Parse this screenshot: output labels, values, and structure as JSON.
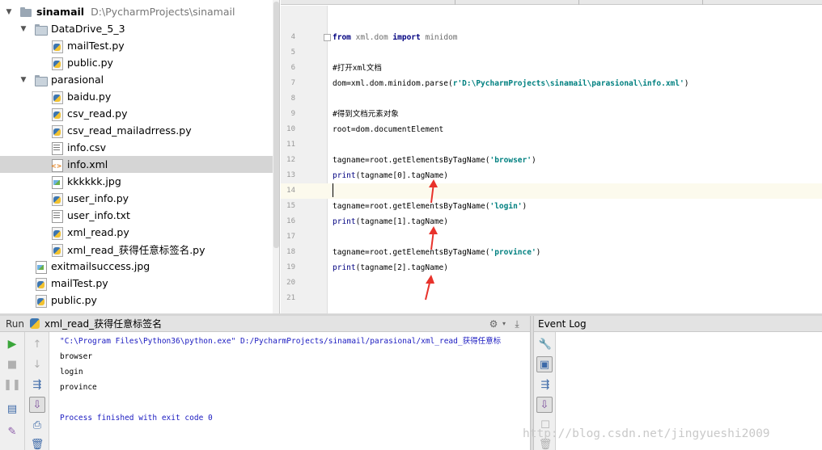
{
  "project_tree": {
    "root": {
      "name": "sinamail",
      "path": "D:\\PycharmProjects\\sinamail"
    },
    "items": [
      {
        "label": "DataDrive_5_3",
        "kind": "folder"
      },
      {
        "label": "mailTest.py",
        "kind": "py"
      },
      {
        "label": "public.py",
        "kind": "py"
      },
      {
        "label": "parasional",
        "kind": "folder"
      },
      {
        "label": "baidu.py",
        "kind": "py"
      },
      {
        "label": "csv_read.py",
        "kind": "py"
      },
      {
        "label": "csv_read_mailadrress.py",
        "kind": "py"
      },
      {
        "label": "info.csv",
        "kind": "csv"
      },
      {
        "label": "info.xml",
        "kind": "xml",
        "selected": true
      },
      {
        "label": "kkkkkk.jpg",
        "kind": "img"
      },
      {
        "label": "user_info.py",
        "kind": "py"
      },
      {
        "label": "user_info.txt",
        "kind": "csv"
      },
      {
        "label": "xml_read.py",
        "kind": "py"
      },
      {
        "label": "xml_read_获得任意标签名.py",
        "kind": "py"
      },
      {
        "label": "exitmailsuccess.jpg",
        "kind": "img"
      },
      {
        "label": "mailTest.py",
        "kind": "py"
      },
      {
        "label": "public.py",
        "kind": "py"
      }
    ]
  },
  "editor": {
    "lines": [
      {
        "num": "4",
        "code": "from xml.dom import minidom"
      },
      {
        "num": "5",
        "code": ""
      },
      {
        "num": "6",
        "code": "#打开xml文档"
      },
      {
        "num": "7",
        "code": "dom=xml.dom.minidom.parse(r'D:\\PycharmProjects\\sinamail\\parasional\\info.xml')"
      },
      {
        "num": "8",
        "code": ""
      },
      {
        "num": "9",
        "code": "#得到文档元素对象"
      },
      {
        "num": "10",
        "code": "root=dom.documentElement"
      },
      {
        "num": "11",
        "code": ""
      },
      {
        "num": "12",
        "code": "tagname=root.getElementsByTagName('browser')"
      },
      {
        "num": "13",
        "code": "print(tagname[0].tagName)"
      },
      {
        "num": "14",
        "code": ""
      },
      {
        "num": "15",
        "code": "tagname=root.getElementsByTagName('login')"
      },
      {
        "num": "16",
        "code": "print(tagname[1].tagName)"
      },
      {
        "num": "17",
        "code": ""
      },
      {
        "num": "18",
        "code": "tagname=root.getElementsByTagName('province')"
      },
      {
        "num": "19",
        "code": "print(tagname[2].tagName)"
      },
      {
        "num": "20",
        "code": ""
      },
      {
        "num": "21",
        "code": ""
      }
    ]
  },
  "run_panel": {
    "label": "Run",
    "config_name": "xml_read_获得任意标签名",
    "console": [
      "\"C:\\Program Files\\Python36\\python.exe\" D:/PycharmProjects/sinamail/parasional/xml_read_获得任意标",
      "browser",
      "login",
      "province",
      "",
      "Process finished with exit code 0"
    ]
  },
  "event_log": {
    "title": "Event Log"
  },
  "watermark": "http://blog.csdn.net/jingyueshi2009",
  "colors": {
    "keyword": "#000080",
    "string": "#008080",
    "comment": "#808080",
    "console_system": "#1a1ac0",
    "arrow": "#e8322b",
    "selection": "#d5d5d5"
  }
}
